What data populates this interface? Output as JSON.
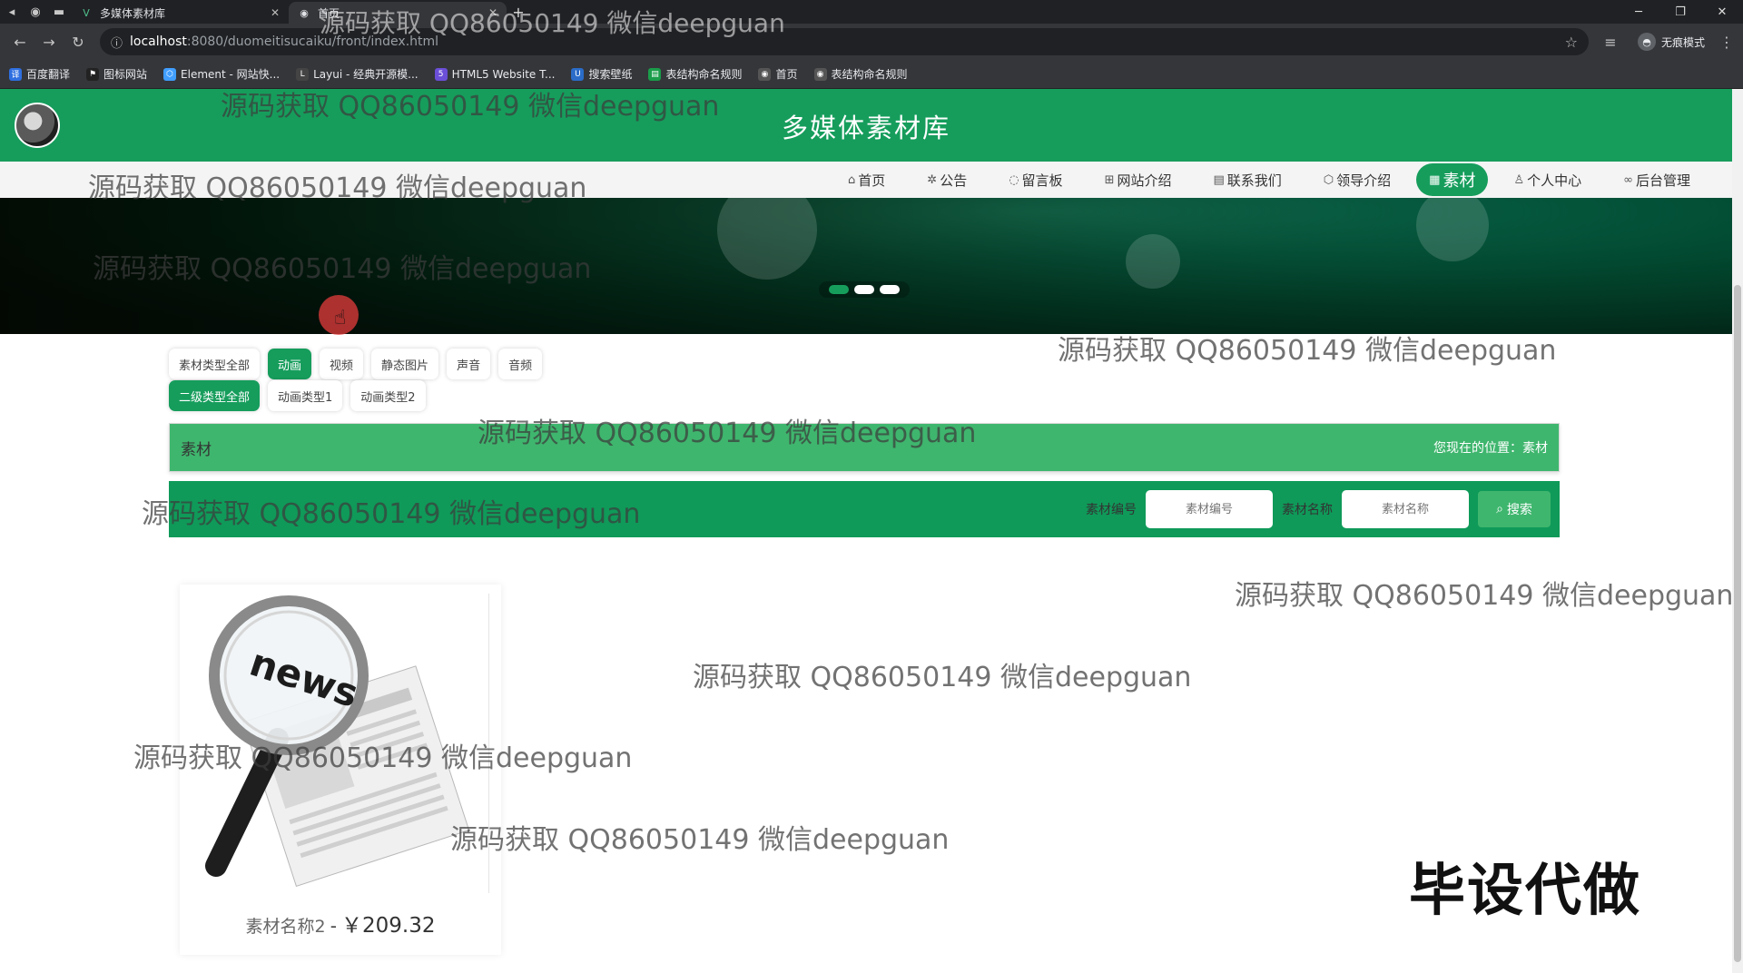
{
  "browser": {
    "tabs": [
      {
        "label": "多媒体素材库",
        "active": false
      },
      {
        "label": "首页",
        "active": true
      }
    ],
    "url_host": "localhost",
    "url_path": ":8080/duomeitisucaiku/front/index.html",
    "incognito_label": "无痕模式",
    "bookmarks": [
      {
        "label": "百度翻译",
        "icon": "translate-icon",
        "color": "#2f6fe0"
      },
      {
        "label": "图标网站",
        "icon": "flag-icon",
        "color": "#333"
      },
      {
        "label": "Element - 网站快...",
        "icon": "element-icon",
        "color": "#409eff"
      },
      {
        "label": "Layui - 经典开源模...",
        "icon": "layui-icon",
        "color": "#555"
      },
      {
        "label": "HTML5 Website T...",
        "icon": "html5-icon",
        "color": "#6b4fd8"
      },
      {
        "label": "搜索壁纸",
        "icon": "wallpaper-icon",
        "color": "#2a6cc8"
      },
      {
        "label": "表结构命名规则",
        "icon": "sheet-icon",
        "color": "#1a9d4a"
      },
      {
        "label": "首页",
        "icon": "globe-icon",
        "color": "#555"
      },
      {
        "label": "表结构命名规则",
        "icon": "globe-icon",
        "color": "#555"
      }
    ]
  },
  "site": {
    "title": "多媒体素材库",
    "nav": [
      {
        "label": "首页",
        "icon": "home-icon",
        "active": false
      },
      {
        "label": "公告",
        "icon": "announcement-icon",
        "active": false
      },
      {
        "label": "留言板",
        "icon": "message-icon",
        "active": false
      },
      {
        "label": "网站介绍",
        "icon": "info-icon",
        "active": false
      },
      {
        "label": "联系我们",
        "icon": "contact-icon",
        "active": false
      },
      {
        "label": "领导介绍",
        "icon": "leader-icon",
        "active": false
      },
      {
        "label": "素材",
        "icon": "material-icon",
        "active": true
      },
      {
        "label": "个人中心",
        "icon": "user-icon",
        "active": false
      },
      {
        "label": "后台管理",
        "icon": "link-icon",
        "active": false
      }
    ],
    "banner_dots": 3,
    "banner_active_dot": 0
  },
  "filters": {
    "types": [
      {
        "label": "素材类型全部",
        "active": false
      },
      {
        "label": "动画",
        "active": true
      },
      {
        "label": "视频",
        "active": false
      },
      {
        "label": "静态图片",
        "active": false
      },
      {
        "label": "声音",
        "active": false
      },
      {
        "label": "音频",
        "active": false
      }
    ],
    "subtypes": [
      {
        "label": "二级类型全部",
        "active": true
      },
      {
        "label": "动画类型1",
        "active": false
      },
      {
        "label": "动画类型2",
        "active": false
      }
    ]
  },
  "breadcrumb": {
    "title": "素材",
    "location": "您现在的位置：素材"
  },
  "search": {
    "code_label": "素材编号",
    "code_placeholder": "素材编号",
    "name_label": "素材名称",
    "name_placeholder": "素材名称",
    "button_label": "搜索"
  },
  "products": [
    {
      "name": "素材名称2",
      "separator": "-",
      "price": "￥209.32",
      "image_text": "news"
    }
  ],
  "watermark_text": "源码获取 QQ86050149 微信deepguan",
  "stamp_text": "毕设代做",
  "colors": {
    "brand": "#169d5c",
    "bar": "#3fb66e"
  }
}
